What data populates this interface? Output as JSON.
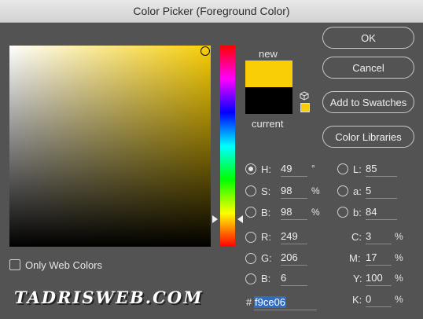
{
  "window": {
    "title": "Color Picker (Foreground Color)"
  },
  "preview": {
    "new_label": "new",
    "current_label": "current",
    "new_color": "#f9ce06",
    "current_color": "#000000"
  },
  "buttons": {
    "ok": "OK",
    "cancel": "Cancel",
    "add_to_swatches": "Add to Swatches",
    "color_libraries": "Color Libraries"
  },
  "hsb": {
    "h_label": "H:",
    "h": "49",
    "h_unit": "°",
    "s_label": "S:",
    "s": "98",
    "s_unit": "%",
    "b_label": "B:",
    "b": "98",
    "b_unit": "%"
  },
  "rgb": {
    "r_label": "R:",
    "r": "249",
    "g_label": "G:",
    "g": "206",
    "b_label": "B:",
    "b": "6"
  },
  "lab": {
    "l_label": "L:",
    "l": "85",
    "a_label": "a:",
    "a": "5",
    "b_label": "b:",
    "b": "84"
  },
  "cmyk": {
    "c_label": "C:",
    "c": "3",
    "m_label": "M:",
    "m": "17",
    "y_label": "Y:",
    "y": "100",
    "k_label": "K:",
    "k": "0",
    "unit": "%"
  },
  "hex": {
    "label": "#",
    "value": "f9ce06"
  },
  "only_web_colors": {
    "label": "Only Web Colors",
    "checked": false
  },
  "selected_component": "H",
  "watermark": "TADRISWEB.COM"
}
